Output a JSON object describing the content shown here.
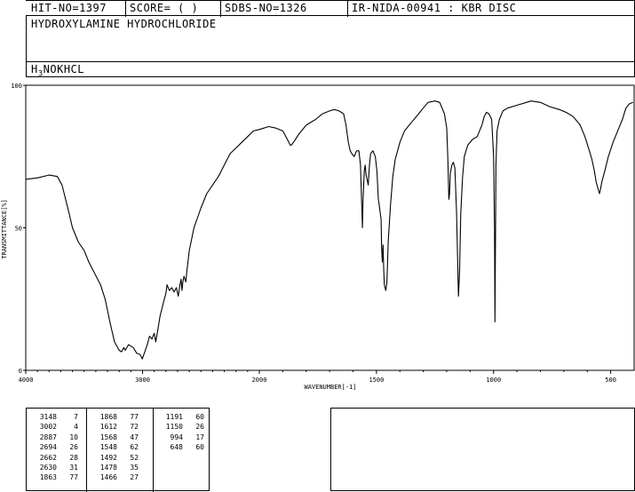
{
  "header": {
    "hit_no": "HIT-NO=1397",
    "score": "SCORE=  (   )",
    "sdbs_no": "SDBS-NO=1326",
    "source": "IR-NIDA-00941 : KBR DISC"
  },
  "compound": {
    "name": "HYDROXYLAMINE HYDROCHLORIDE",
    "formula_main": "H",
    "formula_sub": "3",
    "formula_rest": "NOKHCL"
  },
  "chart_data": {
    "type": "line",
    "title": "",
    "xlabel": "WAVENUMBER[-1]",
    "ylabel": "TRANSMITTANCE[%]",
    "xlim": [
      4000,
      400
    ],
    "ylim": [
      0,
      100
    ],
    "x_ticks": [
      "4000",
      "3000",
      "2000",
      "1500",
      "1000",
      "500"
    ],
    "y_ticks": [
      "100",
      "50",
      "0"
    ],
    "series": [
      {
        "name": "",
        "points": [
          [
            4000,
            67
          ],
          [
            3900,
            67.5
          ],
          [
            3800,
            68.5
          ],
          [
            3730,
            68
          ],
          [
            3690,
            65
          ],
          [
            3640,
            57
          ],
          [
            3600,
            50
          ],
          [
            3550,
            45
          ],
          [
            3500,
            42
          ],
          [
            3460,
            38
          ],
          [
            3410,
            34
          ],
          [
            3360,
            30
          ],
          [
            3320,
            25
          ],
          [
            3280,
            17
          ],
          [
            3240,
            10
          ],
          [
            3200,
            7
          ],
          [
            3180,
            6.5
          ],
          [
            3160,
            8
          ],
          [
            3148,
            7
          ],
          [
            3120,
            9
          ],
          [
            3080,
            8
          ],
          [
            3050,
            6
          ],
          [
            3020,
            5.5
          ],
          [
            3002,
            4
          ],
          [
            2985,
            6
          ],
          [
            2960,
            9
          ],
          [
            2940,
            12
          ],
          [
            2920,
            11
          ],
          [
            2900,
            13
          ],
          [
            2887,
            10
          ],
          [
            2870,
            14
          ],
          [
            2850,
            19
          ],
          [
            2820,
            24
          ],
          [
            2800,
            27
          ],
          [
            2790,
            30
          ],
          [
            2770,
            28
          ],
          [
            2750,
            29
          ],
          [
            2730,
            27.5
          ],
          [
            2710,
            29
          ],
          [
            2694,
            26
          ],
          [
            2680,
            30
          ],
          [
            2670,
            32
          ],
          [
            2662,
            28
          ],
          [
            2655,
            31
          ],
          [
            2645,
            33
          ],
          [
            2630,
            31
          ],
          [
            2620,
            35
          ],
          [
            2600,
            42
          ],
          [
            2560,
            50
          ],
          [
            2500,
            57
          ],
          [
            2450,
            62
          ],
          [
            2400,
            65
          ],
          [
            2350,
            68
          ],
          [
            2300,
            72
          ],
          [
            2250,
            76
          ],
          [
            2200,
            78
          ],
          [
            2150,
            80
          ],
          [
            2100,
            82
          ],
          [
            2050,
            84
          ],
          [
            2000,
            84.5
          ],
          [
            1960,
            85.5
          ],
          [
            1930,
            85
          ],
          [
            1900,
            84
          ],
          [
            1880,
            81
          ],
          [
            1868,
            79
          ],
          [
            1863,
            79
          ],
          [
            1850,
            80.5
          ],
          [
            1830,
            83
          ],
          [
            1800,
            86
          ],
          [
            1760,
            88
          ],
          [
            1730,
            90
          ],
          [
            1700,
            91
          ],
          [
            1680,
            91.5
          ],
          [
            1660,
            91
          ],
          [
            1640,
            90
          ],
          [
            1630,
            86
          ],
          [
            1620,
            80
          ],
          [
            1612,
            77
          ],
          [
            1605,
            76
          ],
          [
            1595,
            75
          ],
          [
            1585,
            77
          ],
          [
            1575,
            77
          ],
          [
            1568,
            72
          ],
          [
            1563,
            58
          ],
          [
            1560,
            50
          ],
          [
            1557,
            60
          ],
          [
            1552,
            70
          ],
          [
            1548,
            72
          ],
          [
            1545,
            69
          ],
          [
            1540,
            67
          ],
          [
            1535,
            65
          ],
          [
            1530,
            72
          ],
          [
            1525,
            76
          ],
          [
            1515,
            77
          ],
          [
            1505,
            75
          ],
          [
            1498,
            70
          ],
          [
            1492,
            60
          ],
          [
            1488,
            58
          ],
          [
            1485,
            56
          ],
          [
            1480,
            53
          ],
          [
            1478,
            43
          ],
          [
            1475,
            38
          ],
          [
            1472,
            44
          ],
          [
            1469,
            35
          ],
          [
            1466,
            30
          ],
          [
            1460,
            28
          ],
          [
            1455,
            31
          ],
          [
            1450,
            45
          ],
          [
            1440,
            58
          ],
          [
            1430,
            68
          ],
          [
            1420,
            74
          ],
          [
            1400,
            80
          ],
          [
            1380,
            84
          ],
          [
            1350,
            87
          ],
          [
            1320,
            90
          ],
          [
            1300,
            92
          ],
          [
            1280,
            94
          ],
          [
            1250,
            94.5
          ],
          [
            1230,
            94
          ],
          [
            1210,
            90
          ],
          [
            1200,
            85
          ],
          [
            1195,
            74
          ],
          [
            1191,
            60
          ],
          [
            1188,
            62
          ],
          [
            1185,
            69
          ],
          [
            1178,
            72
          ],
          [
            1172,
            73
          ],
          [
            1165,
            71
          ],
          [
            1158,
            55
          ],
          [
            1150,
            26
          ],
          [
            1145,
            35
          ],
          [
            1140,
            55
          ],
          [
            1132,
            68
          ],
          [
            1125,
            75
          ],
          [
            1110,
            79
          ],
          [
            1090,
            81
          ],
          [
            1070,
            82
          ],
          [
            1050,
            86
          ],
          [
            1040,
            89
          ],
          [
            1030,
            90.5
          ],
          [
            1020,
            90
          ],
          [
            1008,
            88
          ],
          [
            1000,
            75
          ],
          [
            996,
            50
          ],
          [
            994,
            17
          ],
          [
            992,
            45
          ],
          [
            990,
            72
          ],
          [
            985,
            84
          ],
          [
            975,
            88
          ],
          [
            960,
            91
          ],
          [
            940,
            92
          ],
          [
            900,
            93
          ],
          [
            860,
            94
          ],
          [
            840,
            94.5
          ],
          [
            800,
            94
          ],
          [
            760,
            92.5
          ],
          [
            720,
            91.5
          ],
          [
            690,
            90.5
          ],
          [
            660,
            89
          ],
          [
            630,
            86
          ],
          [
            610,
            82
          ],
          [
            595,
            78
          ],
          [
            580,
            74
          ],
          [
            570,
            70
          ],
          [
            562,
            66
          ],
          [
            555,
            64
          ],
          [
            548,
            62
          ],
          [
            545,
            63
          ],
          [
            538,
            66
          ],
          [
            525,
            70
          ],
          [
            510,
            75
          ],
          [
            490,
            80
          ],
          [
            470,
            84
          ],
          [
            450,
            88
          ],
          [
            435,
            92
          ],
          [
            420,
            93.5
          ],
          [
            405,
            94
          ]
        ]
      }
    ]
  },
  "peak_table": {
    "columns": [
      [
        [
          "3148",
          "7"
        ],
        [
          "3002",
          "4"
        ],
        [
          "2887",
          "10"
        ],
        [
          "2694",
          "26"
        ],
        [
          "2662",
          "28"
        ],
        [
          "2630",
          "31"
        ],
        [
          "1863",
          "77"
        ]
      ],
      [
        [
          "1868",
          "77"
        ],
        [
          "1612",
          "72"
        ],
        [
          "1568",
          "47"
        ],
        [
          "1548",
          "62"
        ],
        [
          "1492",
          "52"
        ],
        [
          "1478",
          "35"
        ],
        [
          "1466",
          "27"
        ]
      ],
      [
        [
          "1191",
          "60"
        ],
        [
          "1150",
          "26"
        ],
        [
          "994",
          "17"
        ],
        [
          "648",
          "60"
        ]
      ]
    ]
  }
}
